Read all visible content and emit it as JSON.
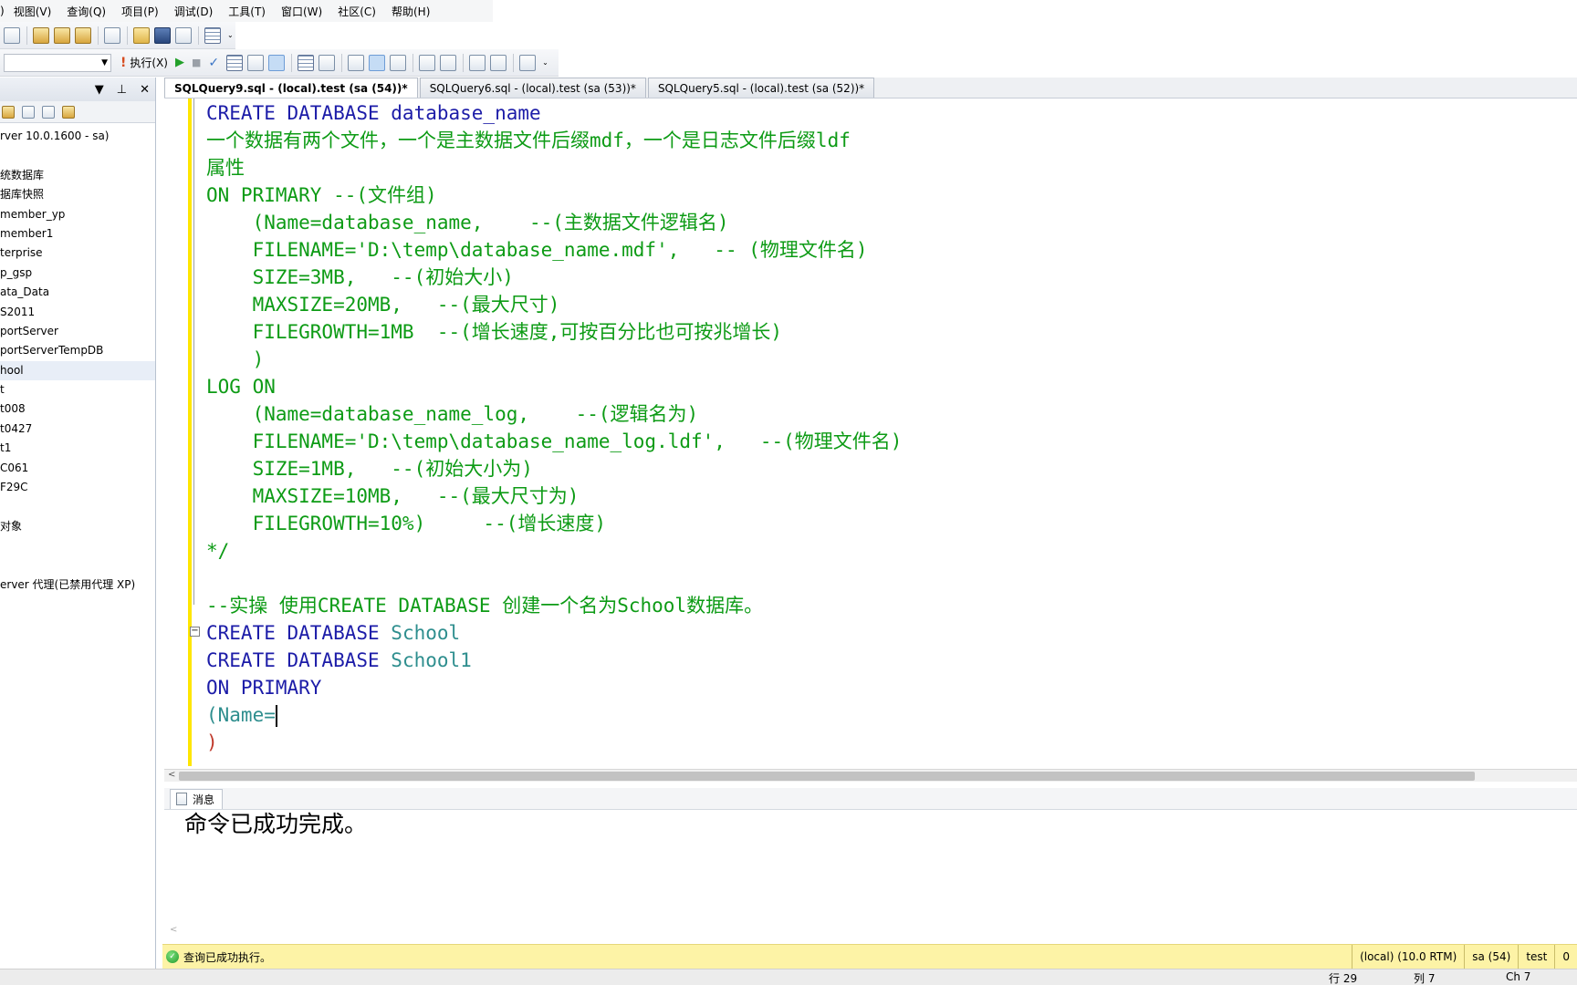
{
  "menu": [
    "视图(V)",
    "查询(Q)",
    "项目(P)",
    "调试(D)",
    "工具(T)",
    "窗口(W)",
    "社区(C)",
    "帮助(H)"
  ],
  "menu_prefix": ")",
  "toolbar": {
    "execute_label": "执行(X)",
    "execute_icon": "!",
    "run_icon": "▶",
    "stop_icon": "■",
    "check_icon": "✓",
    "overflow": "⌄"
  },
  "explorer": {
    "header_icons": {
      "dropdown": "▼",
      "pin": "⊥",
      "close": "✕"
    },
    "tree": [
      "rver 10.0.1600 - sa)",
      "",
      "统数据库",
      "据库快照",
      "member_yp",
      "member1",
      "terprise",
      "p_gsp",
      "ata_Data",
      "S2011",
      "portServer",
      "portServerTempDB",
      "hool",
      "t",
      "t008",
      "t0427",
      "t1",
      "C061",
      "F29C",
      "",
      "对象",
      "",
      "",
      "erver 代理(已禁用代理 XP)"
    ],
    "selected_index": 12
  },
  "tabs": [
    {
      "label": "SQLQuery9.sql - (local).test (sa (54))*",
      "active": true
    },
    {
      "label": "SQLQuery6.sql - (local).test (sa (53))*",
      "active": false
    },
    {
      "label": "SQLQuery5.sql - (local).test (sa (52))*",
      "active": false
    }
  ],
  "code": {
    "l1": "CREATE DATABASE database_name",
    "l2": "一个数据有两个文件，一个是主数据文件后缀mdf，一个是日志文件后缀ldf",
    "l3": "属性",
    "l4": "ON PRIMARY --(文件组)",
    "l5": "    (Name=database_name,    --(主数据文件逻辑名)",
    "l6": "    FILENAME='D:\\temp\\database_name.mdf',   -- (物理文件名)",
    "l7": "    SIZE=3MB,   --(初始大小)",
    "l8": "    MAXSIZE=20MB,   --(最大尺寸)",
    "l9": "    FILEGROWTH=1MB  --(增长速度,可按百分比也可按兆增长)",
    "l10": "    )",
    "l11": "LOG ON",
    "l12": "    (Name=database_name_log,    --(逻辑名为)",
    "l13": "    FILENAME='D:\\temp\\database_name_log.ldf',   --(物理文件名)",
    "l14": "    SIZE=1MB,   --(初始大小为)",
    "l15": "    MAXSIZE=10MB,   --(最大尺寸为)",
    "l16": "    FILEGROWTH=10%)     --(增长速度)",
    "l17": "*/",
    "l18": "",
    "l19": "--实操 使用CREATE DATABASE 创建一个名为School数据库。",
    "l20_kw": "CREATE DATABASE ",
    "l20_id": "School",
    "l21_kw": "CREATE DATABASE ",
    "l21_id": "School1",
    "l22": "ON PRIMARY",
    "l23": "(Name=",
    "l24": ")"
  },
  "messages": {
    "tab_label": "消息",
    "text": "命令已成功完成。"
  },
  "status": {
    "message": "查询已成功执行。",
    "server": "(local) (10.0 RTM)",
    "user": "sa (54)",
    "database": "test",
    "extra": "0"
  },
  "position": {
    "row": "行 29",
    "col": "列 7",
    "ch": "Ch 7"
  },
  "colors": {
    "comment": "#0d9b15",
    "keyword": "#1c1ca8",
    "identifier": "#2e8e8e",
    "status_bar": "#fdf3a6",
    "modified_margin": "#ffe600"
  }
}
